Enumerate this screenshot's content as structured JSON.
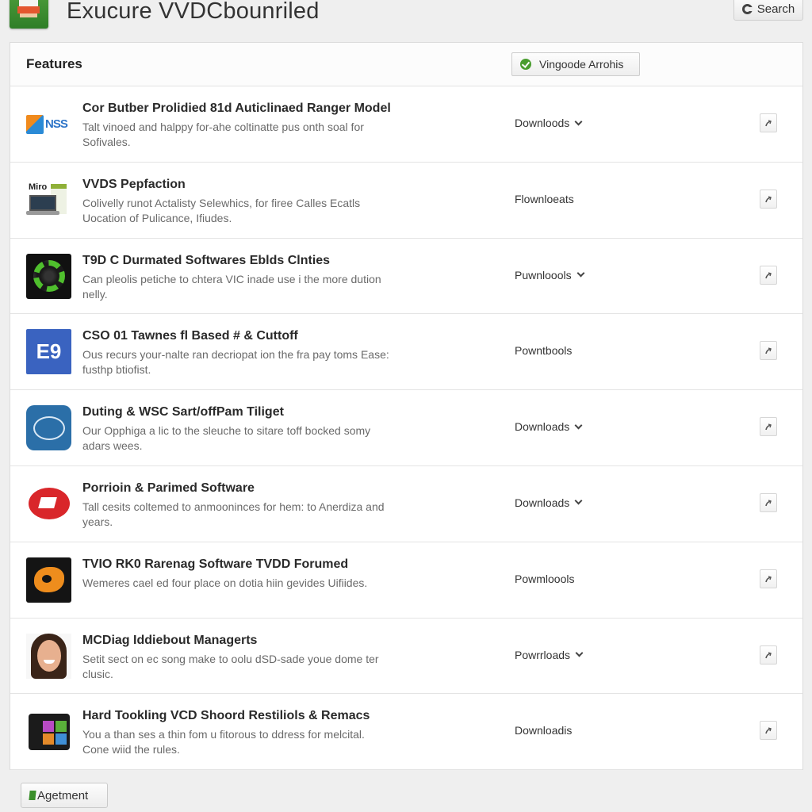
{
  "app": {
    "title": "Exucure VVDCbounriled",
    "logo_icon": "app-logo-icon"
  },
  "header": {
    "search_label": "Search",
    "search_icon": "gear-search-icon"
  },
  "panel": {
    "title": "Features",
    "upgrade_button_label": "Vingoode Arrohis",
    "upgrade_icon": "check-circle-icon"
  },
  "items": [
    {
      "name": "Cor Butber Prolidied 81d Auticlinaed Ranger Model",
      "description": "Talt vinoed and halppy for-ahe coltinatte pus onth soal for Sofivales.",
      "download_label": "Downloods",
      "has_dropdown": true,
      "icon": "nss-cube-logo-icon"
    },
    {
      "name": "VVDS Pepfaction",
      "description": "Colivelly runot Actalisty Selewhics, for firee Calles Ecatls Uocation of Pulicance, Ifiudes.",
      "download_label": "Flownloeats",
      "has_dropdown": false,
      "icon": "miro-laptop-box-icon"
    },
    {
      "name": "T9D C Durmated Softwares Eblds Clnties",
      "description": "Can pleolis petiche to chtera VIC inade use i the more dution nelly.",
      "download_label": "Puwnloools",
      "has_dropdown": true,
      "icon": "green-ring-icon"
    },
    {
      "name": "CSO 01 Tawnes fl Based # & Cuttoff",
      "description": "Ous recurs your-nalte ran decriopat ion the fra pay toms Ease: fusthp btiofist.",
      "download_label": "Powntbools",
      "has_dropdown": false,
      "icon": "e9-shield-icon"
    },
    {
      "name": "Duting & WSC Sart/offPam Tiliget",
      "description": "Our Opphiga a lic to the sleuche to sitare toff bocked somy adars wees.",
      "download_label": "Downloads",
      "has_dropdown": true,
      "icon": "blue-rounded-badge-icon"
    },
    {
      "name": "Porrioin & Parimed Software",
      "description": "Tall cesits coltemed to anmooninces for hem: to Anerdiza and years.",
      "download_label": "Downloads",
      "has_dropdown": true,
      "icon": "red-speech-bubble-icon"
    },
    {
      "name": "TVIO RK0 Rarenag Software TVDD Forumed",
      "description": "Wemeres cael ed four place on dotia hiin gevides Uifiides.",
      "download_label": "Powmloools",
      "has_dropdown": false,
      "icon": "orange-creature-icon"
    },
    {
      "name": "MCDiag Iddiebout Managerts",
      "description": "Setit sect on ec song make to oolu dSD-sade youe dome ter clusic.",
      "download_label": "Powrrloads",
      "has_dropdown": true,
      "icon": "woman-avatar-icon"
    },
    {
      "name": "Hard Tookling VCD Shoord Restiliols & Remacs",
      "description": "You a than ses a thin fom u fitorous to ddress for melcital. Cone wiid the rules.",
      "download_label": "Downloadis",
      "has_dropdown": false,
      "icon": "tablet-tiles-icon"
    }
  ],
  "footer": {
    "management_label": "Agetment",
    "management_icon": "green-flag-icon"
  },
  "colors": {
    "accent_green": "#4a9d2f",
    "background": "#efefef",
    "panel": "#ffffff"
  }
}
